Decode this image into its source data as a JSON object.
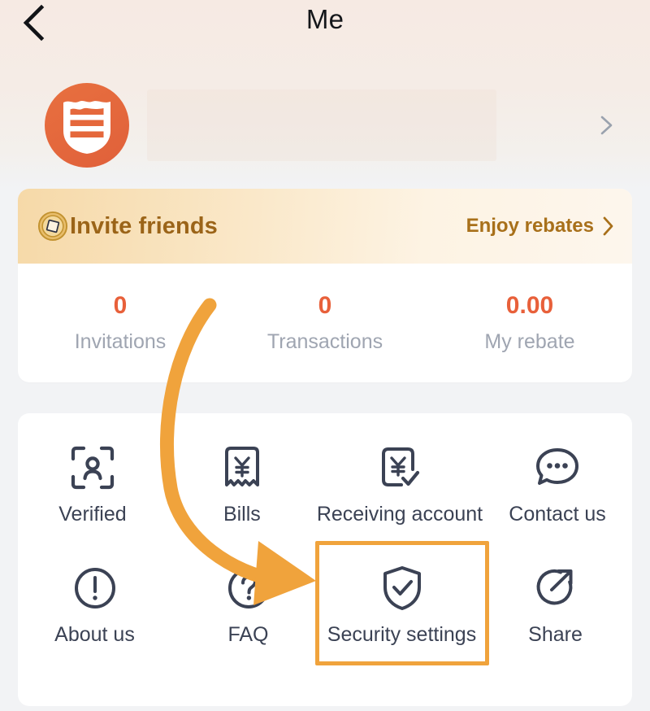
{
  "navbar": {
    "back_icon": "chevron-left-icon",
    "title": "Me"
  },
  "profile": {
    "avatar_icon": "shield-badge-logo",
    "name": "",
    "chevron_icon": "chevron-right-icon"
  },
  "invite": {
    "coin_icon": "coin-icon",
    "label": "Invite friends",
    "rebates_label": "Enjoy rebates",
    "rebates_chevron_icon": "chevron-right-icon",
    "accent_color": "#a8701a"
  },
  "stats": [
    {
      "value": "0",
      "label": "Invitations"
    },
    {
      "value": "0",
      "label": "Transactions"
    },
    {
      "value": "0.00",
      "label": "My rebate"
    }
  ],
  "menu": {
    "rows": [
      [
        {
          "label": "Verified",
          "icon": "face-scan-icon"
        },
        {
          "label": "Bills",
          "icon": "receipt-yen-icon"
        },
        {
          "label": "Receiving account",
          "icon": "card-yen-check-icon"
        },
        {
          "label": "Contact us",
          "icon": "chat-bubble-dots-icon"
        }
      ],
      [
        {
          "label": "About us",
          "icon": "exclamation-circle-icon"
        },
        {
          "label": "FAQ",
          "icon": "question-circle-icon"
        },
        {
          "label": "Security settings",
          "icon": "shield-check-icon",
          "highlighted": true
        },
        {
          "label": "Share",
          "icon": "share-circle-arrow-icon"
        }
      ]
    ]
  },
  "annotation": {
    "arrow_icon": "curved-arrow-annotation",
    "color": "#f0a33c",
    "points_to": "Security settings"
  },
  "colors": {
    "page_background": "#f2f3f5",
    "card_background": "#ffffff",
    "brand_orange": "#e8603a",
    "highlight_orange": "#f0a33c",
    "stat_label_grey": "#9fa5b1",
    "menu_label_navy": "#3b4254"
  }
}
